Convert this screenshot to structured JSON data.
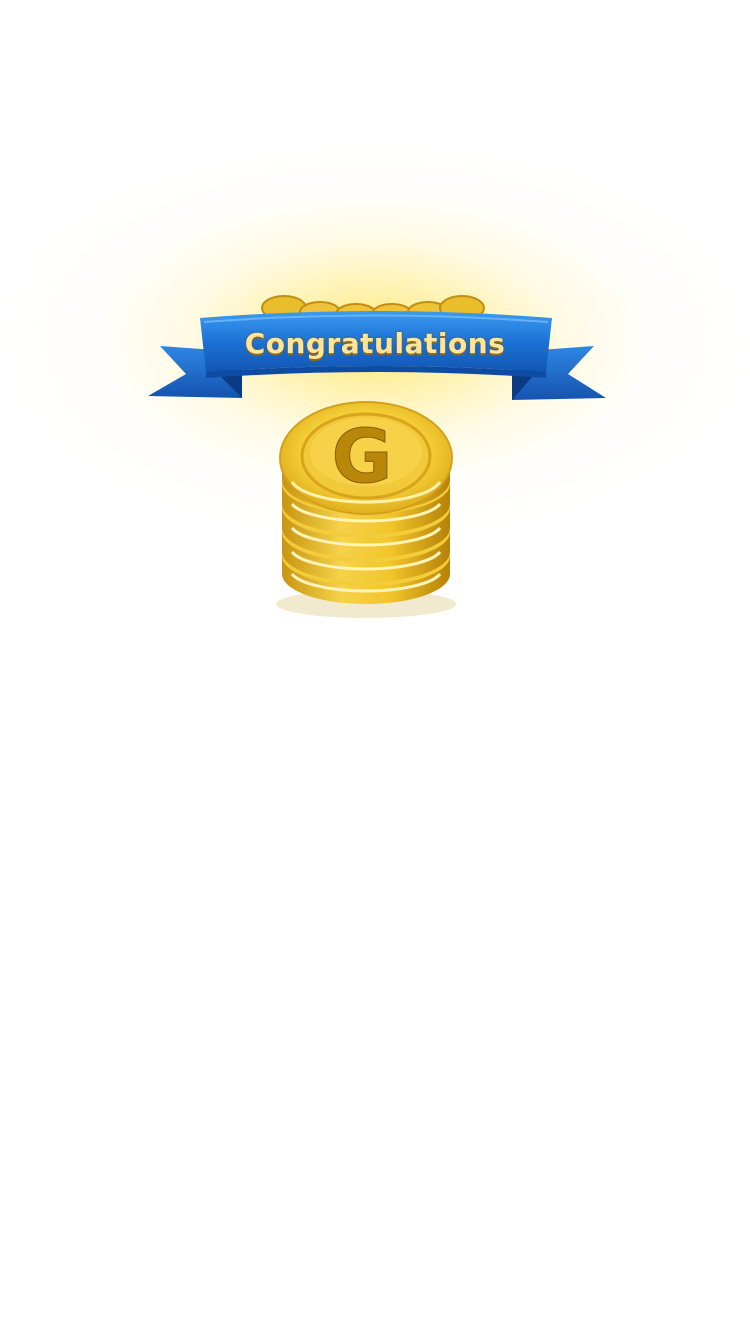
{
  "reward": {
    "banner_title": "Congratulations",
    "coin_letter": "G",
    "coin_icon": "coin-stack-icon"
  },
  "colors": {
    "banner_blue": "#1a6fd1",
    "banner_blue_dark": "#0d3f8f",
    "gold": "#f3c51e",
    "gold_dark": "#b8860b",
    "glow": "#ffe25a",
    "background": "#ffffff"
  }
}
